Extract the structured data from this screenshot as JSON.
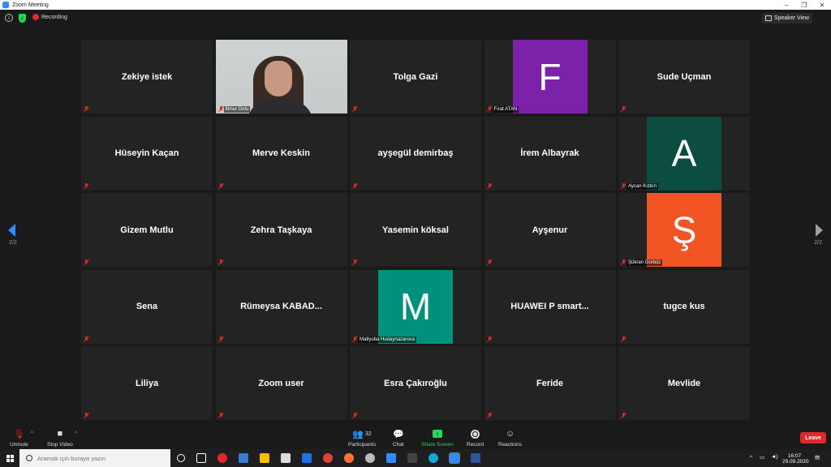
{
  "window": {
    "title": "Zoom Meeting",
    "controls": [
      "–",
      "❐",
      "✕"
    ]
  },
  "topbar": {
    "recording_label": "Recording",
    "view_button_label": "Speaker View"
  },
  "tiles": [
    {
      "name": "Zekiye istek",
      "label": "",
      "avatar": ""
    },
    {
      "name": "",
      "label": "İlknur Dolu",
      "avatar": "",
      "video": true
    },
    {
      "name": "Tolga Gazi",
      "label": "",
      "avatar": ""
    },
    {
      "name": "",
      "label": "Fırat ATAN",
      "avatar": "F",
      "avatar_color": "#7b22a8"
    },
    {
      "name": "Sude Uçman",
      "label": "",
      "avatar": ""
    },
    {
      "name": "Hüseyin Kaçan",
      "label": "",
      "avatar": ""
    },
    {
      "name": "Merve Keskin",
      "label": "",
      "avatar": ""
    },
    {
      "name": "ayşegül demirbaş",
      "label": "",
      "avatar": ""
    },
    {
      "name": "İrem Albayrak",
      "label": "",
      "avatar": ""
    },
    {
      "name": "",
      "label": "Aycan Kızkın",
      "avatar": "A",
      "avatar_color": "#0b4d3e"
    },
    {
      "name": "Gizem Mutlu",
      "label": "",
      "avatar": ""
    },
    {
      "name": "Zehra Taşkaya",
      "label": "",
      "avatar": ""
    },
    {
      "name": "Yasemin köksal",
      "label": "",
      "avatar": ""
    },
    {
      "name": "Ayşenur",
      "label": "",
      "avatar": ""
    },
    {
      "name": "",
      "label": "Şükran Gürbüz",
      "avatar": "Ş",
      "avatar_color": "#f35424"
    },
    {
      "name": "Sena",
      "label": "",
      "avatar": ""
    },
    {
      "name": "Rümeysa  KABAD...",
      "label": "",
      "avatar": ""
    },
    {
      "name": "",
      "label": "Matlyuba Hudaynazarova",
      "avatar": "M",
      "avatar_color": "#00917c"
    },
    {
      "name": "HUAWEI P smart...",
      "label": "",
      "avatar": ""
    },
    {
      "name": "tugce kus",
      "label": "",
      "avatar": ""
    },
    {
      "name": "Liliya",
      "label": "",
      "avatar": ""
    },
    {
      "name": "Zoom user",
      "label": "",
      "avatar": ""
    },
    {
      "name": "Esra Çakıroğlu",
      "label": "",
      "avatar": ""
    },
    {
      "name": "Feride",
      "label": "",
      "avatar": ""
    },
    {
      "name": "Mevlide",
      "label": "",
      "avatar": ""
    }
  ],
  "pagination": {
    "left": "2/2",
    "right": "2/2"
  },
  "toolbar": {
    "unmute": "Unmute",
    "stop_video": "Stop Video",
    "participants": "Participants",
    "participants_count": "32",
    "chat": "Chat",
    "share_screen": "Share Screen",
    "record": "Record",
    "reactions": "Reactions",
    "leave": "Leave"
  },
  "taskbar": {
    "search_placeholder": "Aramak için buraya yazın",
    "time": "16:07",
    "date": "29.09.2020"
  },
  "colors": {
    "accent": "#2d8cff",
    "leave": "#e02828",
    "share": "#23d959"
  }
}
